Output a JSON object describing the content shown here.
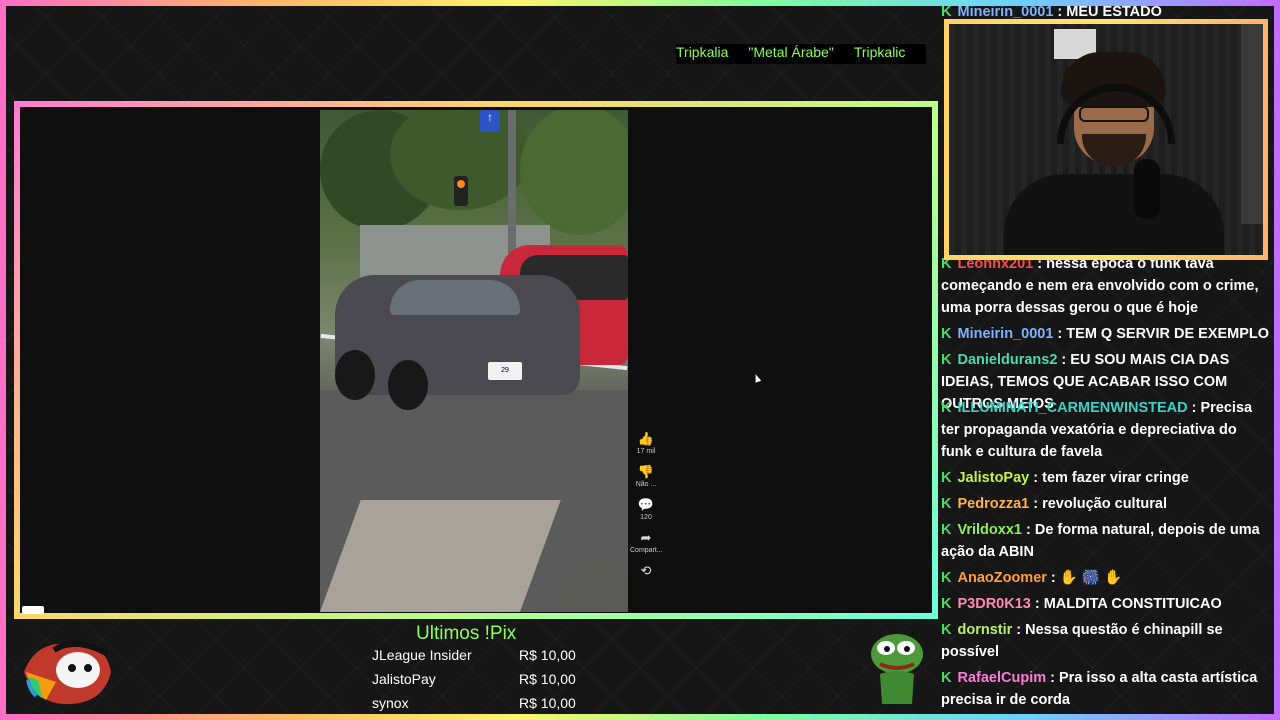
{
  "ticker": {
    "items": [
      "Tripkalia",
      "\"Metal Árabe\"",
      "Tripkalic"
    ]
  },
  "video": {
    "plate_text": "29",
    "actions": [
      {
        "icon": "like-icon",
        "glyph": "👍",
        "label": "17 mil"
      },
      {
        "icon": "dislike-icon",
        "glyph": "👎",
        "label": "Não ..."
      },
      {
        "icon": "comments-icon",
        "glyph": "💬",
        "label": "120"
      },
      {
        "icon": "share-icon",
        "glyph": "➦",
        "label": "Compart..."
      },
      {
        "icon": "remix-icon",
        "glyph": "⟲",
        "label": ""
      }
    ]
  },
  "chat": {
    "badge": "K",
    "messages": [
      {
        "user": "Mineirin_0001",
        "color": "#7fb2ff",
        "text": " : MEU ESTADO"
      },
      {
        "user": "Leonnx201",
        "color": "#ff4a4a",
        "text": " : nessa época o funk tava começando e nem era envolvido com o crime, uma porra dessas gerou o que é hoje"
      },
      {
        "user": "Mineirin_0001",
        "color": "#7fb2ff",
        "text": " : TEM Q SERVIR DE EXEMPLO"
      },
      {
        "user": "Danieldurans2",
        "color": "#4cd9b0",
        "text": " : EU SOU MAIS CIA DAS IDEIAS, TEMOS QUE ACABAR ISSO COM OUTROS MEIOS"
      },
      {
        "user": "ILLUMINATI_CARMENWINSTEAD",
        "color": "#3fd1c4",
        "text": " : Precisa ter propaganda vexatória e depreciativa do funk e cultura de favela"
      },
      {
        "user": "JalistoPay",
        "color": "#c8f04a",
        "text": " : tem fazer virar cringe"
      },
      {
        "user": "Pedrozza1",
        "color": "#ffb24a",
        "text": " : revolução cultural"
      },
      {
        "user": "Vrildoxx1",
        "color": "#8cf05a",
        "text": " : De forma natural, depois de uma ação da ABIN"
      },
      {
        "user": "AnaoZoomer",
        "color": "#ff9f3a",
        "text": " : ✋ 🎆 ✋"
      },
      {
        "user": "P3DR0K13",
        "color": "#ff8ab0",
        "text": " : MALDITA CONSTITUICAO"
      },
      {
        "user": "dornstir",
        "color": "#b9f06a",
        "text": " : Nessa questão é chinapill se possível"
      },
      {
        "user": "RafaelCupim",
        "color": "#ff7ad9",
        "text": " : Pra isso a alta casta artística precisa ir de corda"
      }
    ]
  },
  "pix": {
    "title": "Ultimos !Pix",
    "rows": [
      {
        "name": "JLeague Insider",
        "value": "R$ 10,00"
      },
      {
        "name": "JalistoPay",
        "value": "R$ 10,00"
      },
      {
        "name": "synox",
        "value": "R$ 10,00"
      }
    ]
  }
}
